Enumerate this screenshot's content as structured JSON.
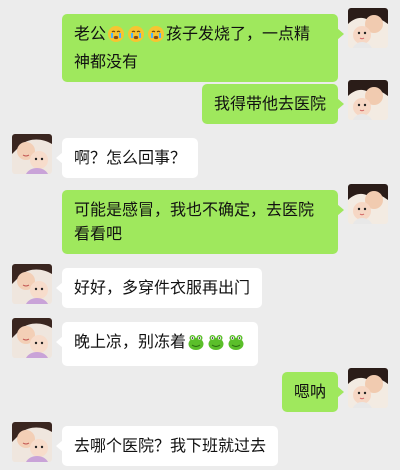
{
  "messages": [
    {
      "side": "right",
      "avatar": "woman-with-baby-avatar",
      "parts": [
        {
          "t": "text",
          "v": "老公"
        },
        {
          "t": "emoji",
          "v": "crying-face-emoji"
        },
        {
          "t": "emoji",
          "v": "crying-face-emoji"
        },
        {
          "t": "emoji",
          "v": "crying-face-emoji"
        },
        {
          "t": "text",
          "v": "孩子发烧了，一点精"
        }
      ],
      "line2": "神都没有"
    },
    {
      "side": "right",
      "avatar": "woman-with-baby-avatar",
      "text": "我得带他去医院"
    },
    {
      "side": "left",
      "avatar": "mother-child-avatar",
      "text": "啊？怎么回事？"
    },
    {
      "side": "right",
      "avatar": "woman-with-baby-avatar",
      "text": "可能是感冒，我也不确定，去医院",
      "line2": "看看吧"
    },
    {
      "side": "left",
      "avatar": "mother-child-avatar",
      "text": "好好，多穿件衣服再出门"
    },
    {
      "side": "left",
      "avatar": "mother-child-avatar",
      "parts": [
        {
          "t": "text",
          "v": "晚上凉，别冻着"
        },
        {
          "t": "emoji",
          "v": "frog-emoji"
        },
        {
          "t": "emoji",
          "v": "frog-emoji"
        },
        {
          "t": "emoji",
          "v": "frog-emoji"
        }
      ]
    },
    {
      "side": "right",
      "avatar": "woman-with-baby-avatar",
      "text": "嗯呐"
    },
    {
      "side": "left",
      "avatar": "mother-child-avatar",
      "text": "去哪个医院？我下班就过去"
    }
  ],
  "colors": {
    "background": "#ececec",
    "outgoing_bubble": "#9fe85d",
    "incoming_bubble": "#ffffff"
  }
}
